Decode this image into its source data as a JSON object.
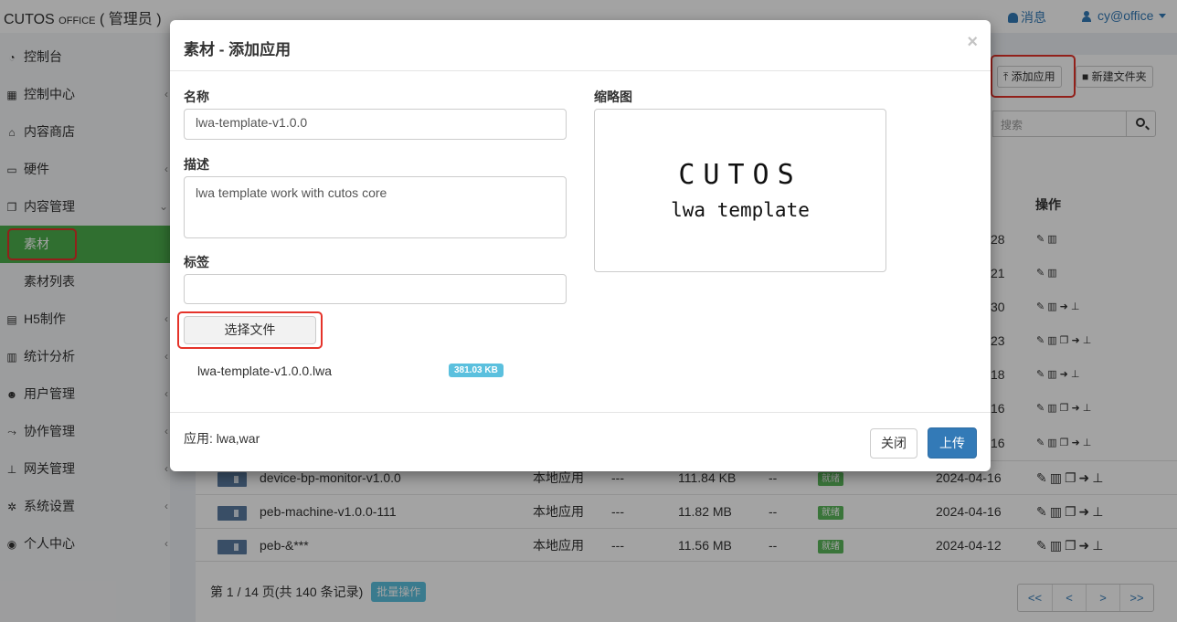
{
  "header": {
    "brand_main": "CUTOS",
    "brand_small": "OFFICE",
    "brand_role": "( 管理员 )",
    "messages_label": "消息",
    "user_label": "cy@office"
  },
  "sidebar": {
    "items": [
      {
        "label": "控制台",
        "icon": "dashboard-icon"
      },
      {
        "label": "控制中心",
        "icon": "grid-icon"
      },
      {
        "label": "内容商店",
        "icon": "bank-icon"
      },
      {
        "label": "硬件",
        "icon": "monitor-icon"
      },
      {
        "label": "内容管理",
        "icon": "copy-icon"
      },
      {
        "label": "素材",
        "icon": ""
      },
      {
        "label": "素材列表",
        "icon": ""
      },
      {
        "label": "H5制作",
        "icon": "book-icon"
      },
      {
        "label": "统计分析",
        "icon": "bar-chart-icon"
      },
      {
        "label": "用户管理",
        "icon": "users-icon"
      },
      {
        "label": "协作管理",
        "icon": "share-icon"
      },
      {
        "label": "网关管理",
        "icon": "sitemap-icon"
      },
      {
        "label": "系统设置",
        "icon": "gear-icon"
      },
      {
        "label": "个人中心",
        "icon": "user-circle-icon"
      }
    ]
  },
  "toolbar": {
    "add_app_label": "添加应用",
    "new_folder_label": "新建文件夹",
    "search_placeholder": "搜索",
    "ops_header": "操作"
  },
  "table": {
    "partial_dates": [
      "28",
      "21",
      "30",
      "23",
      "18",
      "16",
      "16"
    ],
    "rows": [
      {
        "name": "device-bp-monitor-v1.0.0",
        "type": "本地应用",
        "dash": "---",
        "size": "111.84 KB",
        "dash2": "--",
        "status": "就绪",
        "date": "2024-04-16"
      },
      {
        "name": "peb-machine-v1.0.0-111",
        "type": "本地应用",
        "dash": "---",
        "size": "11.82 MB",
        "dash2": "--",
        "status": "就绪",
        "date": "2024-04-16"
      },
      {
        "name": "peb-&***",
        "type": "本地应用",
        "dash": "---",
        "size": "11.56 MB",
        "dash2": "--",
        "status": "就绪",
        "date": "2024-04-12"
      }
    ]
  },
  "pagination": {
    "summary": "第 1 / 14 页(共 140 条记录)",
    "batch_label": "批量操作",
    "first": "<<",
    "prev": "<",
    "next": ">",
    "last": ">>"
  },
  "modal": {
    "title": "素材 - 添加应用",
    "close_x": "×",
    "name_label": "名称",
    "name_value": "lwa-template-v1.0.0",
    "desc_label": "描述",
    "desc_value": "lwa template work with cutos core",
    "tags_label": "标签",
    "tags_value": "",
    "choose_file_label": "选择文件",
    "file_name": "lwa-template-v1.0.0.lwa",
    "file_size": "381.03 KB",
    "thumb_label": "缩略图",
    "thumb_title": "CUTOS",
    "thumb_subtitle": "lwa template",
    "apps_note": "应用: lwa,war",
    "close_label": "关闭",
    "upload_label": "上传"
  },
  "colors": {
    "highlight": "#e5332a",
    "primary": "#337ab7",
    "active_nav": "#4cae4c",
    "badge_info": "#5bc0de",
    "badge_success": "#5cb85c"
  }
}
